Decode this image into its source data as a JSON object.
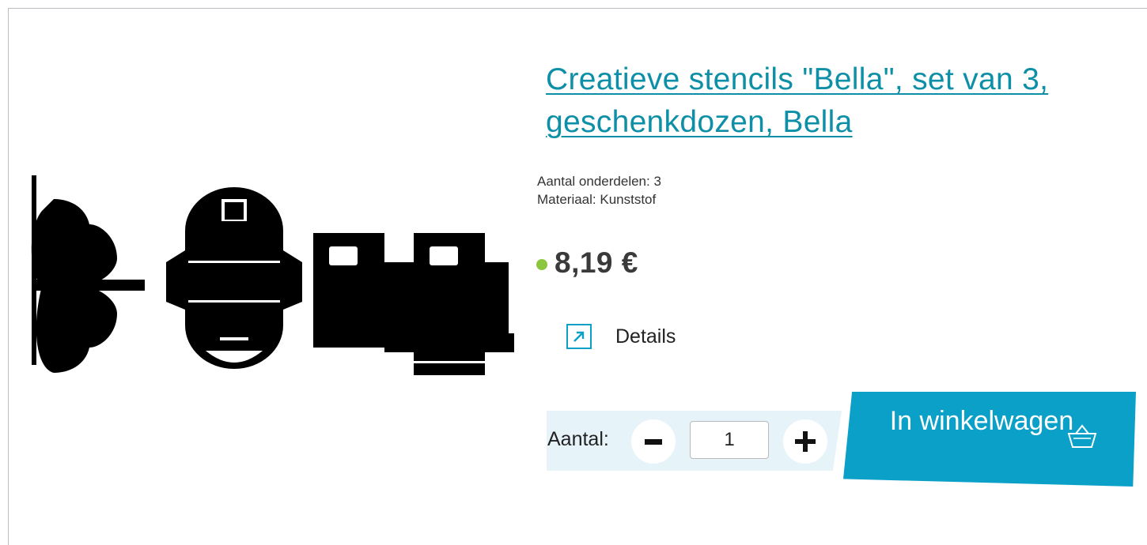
{
  "product": {
    "title": "Creatieve stencils \"Bella\", set van 3, geschenkdozen, Bella",
    "specs": [
      "Aantal onderdelen: 3",
      "Materiaal: Kunststof"
    ],
    "price": "8,19 €",
    "availability_color": "#8cc63f"
  },
  "details": {
    "label": "Details",
    "icon": "external-arrow-icon"
  },
  "quantity": {
    "label": "Aantal:",
    "value": "1"
  },
  "cart": {
    "label": "In winkelwagen",
    "icon": "basket-icon",
    "color": "#0aa0c8"
  },
  "colors": {
    "link": "#0e8fa8",
    "panel": "#e6f4f9"
  }
}
